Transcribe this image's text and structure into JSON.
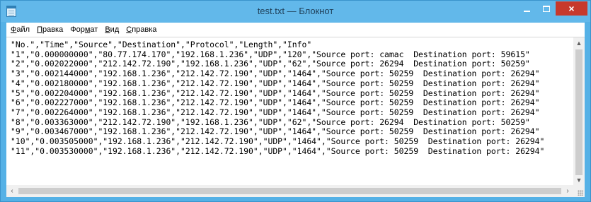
{
  "window": {
    "title": "test.txt — Блокнот",
    "buttons": {
      "minimize": "minimize",
      "maximize": "maximize",
      "close": "×"
    }
  },
  "menu": [
    {
      "accel": "Ф",
      "rest": "айл"
    },
    {
      "accel": "П",
      "rest": "равка"
    },
    {
      "pre": "Фор",
      "accel": "м",
      "rest": "ат"
    },
    {
      "accel": "В",
      "rest": "ид"
    },
    {
      "accel": "С",
      "rest": "правка"
    }
  ],
  "document": {
    "lines": [
      "\"No.\",\"Time\",\"Source\",\"Destination\",\"Protocol\",\"Length\",\"Info\"",
      "\"1\",\"0.000000000\",\"80.77.174.170\",\"192.168.1.236\",\"UDP\",\"120\",\"Source port: camac  Destination port: 59615\"",
      "\"2\",\"0.002022000\",\"212.142.72.190\",\"192.168.1.236\",\"UDP\",\"62\",\"Source port: 26294  Destination port: 50259\"",
      "\"3\",\"0.002144000\",\"192.168.1.236\",\"212.142.72.190\",\"UDP\",\"1464\",\"Source port: 50259  Destination port: 26294\"",
      "\"4\",\"0.002180000\",\"192.168.1.236\",\"212.142.72.190\",\"UDP\",\"1464\",\"Source port: 50259  Destination port: 26294\"",
      "\"5\",\"0.002204000\",\"192.168.1.236\",\"212.142.72.190\",\"UDP\",\"1464\",\"Source port: 50259  Destination port: 26294\"",
      "\"6\",\"0.002227000\",\"192.168.1.236\",\"212.142.72.190\",\"UDP\",\"1464\",\"Source port: 50259  Destination port: 26294\"",
      "\"7\",\"0.002264000\",\"192.168.1.236\",\"212.142.72.190\",\"UDP\",\"1464\",\"Source port: 50259  Destination port: 26294\"",
      "\"8\",\"0.003363000\",\"212.142.72.190\",\"192.168.1.236\",\"UDP\",\"62\",\"Source port: 26294  Destination port: 50259\"",
      "\"9\",\"0.003467000\",\"192.168.1.236\",\"212.142.72.190\",\"UDP\",\"1464\",\"Source port: 50259  Destination port: 26294\"",
      "\"10\",\"0.003505000\",\"192.168.1.236\",\"212.142.72.190\",\"UDP\",\"1464\",\"Source port: 50259  Destination port: 26294\"",
      "\"11\",\"0.003530000\",\"192.168.1.236\",\"212.142.72.190\",\"UDP\",\"1464\",\"Source port: 50259  Destination port: 26294\""
    ]
  },
  "scrollbars": {
    "up_arrow": "▲",
    "down_arrow": "▼",
    "left_arrow": "‹",
    "right_arrow": "›"
  },
  "colors": {
    "title_bar": "#62b8ea",
    "close_button": "#c7392c"
  }
}
